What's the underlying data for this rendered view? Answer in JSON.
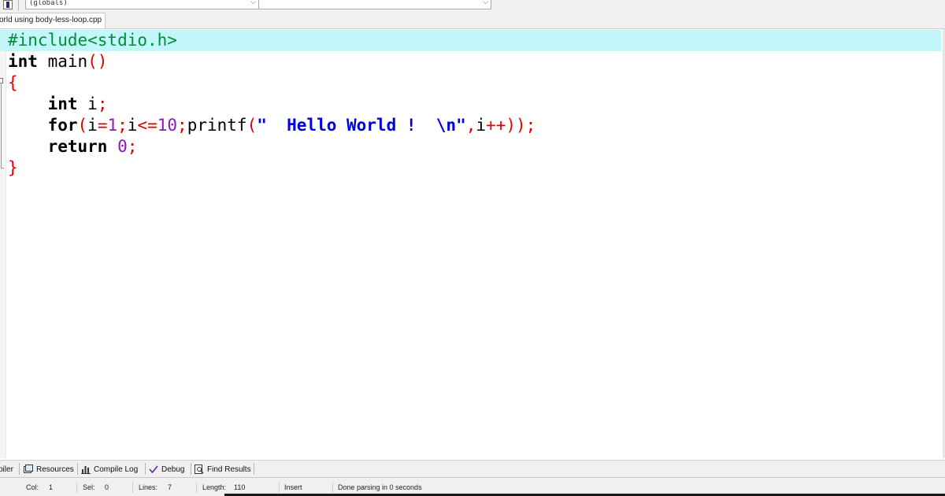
{
  "toolbar": {
    "scope_combo": "(globals)",
    "member_combo": ""
  },
  "file_tab": {
    "label": "orld using body-less-loop.cpp"
  },
  "code": {
    "line1": {
      "pre": "#include<stdio.h>"
    },
    "line2": {
      "kw": "int",
      "name": " main",
      "paren": "()"
    },
    "line3": {
      "brace": "{"
    },
    "line4": {
      "indent": "    ",
      "kw": "int",
      "name": " i",
      "semi": ";"
    },
    "line5": {
      "indent": "    ",
      "kw": "for",
      "p_open": "(",
      "v1": "i",
      "eq": "=",
      "n1": "1",
      "s1": ";",
      "v2": "i",
      "le": "<=",
      "n2": "10",
      "s2": ";",
      "fn": "printf",
      "p2": "(",
      "str": "\"  Hello World !  \\n\"",
      "comma": ",",
      "v3": "i",
      "inc": "++",
      "p_close": "));"
    },
    "line6": {
      "indent": "    ",
      "kw": "return",
      "sp": " ",
      "num": "0",
      "semi": ";"
    },
    "line7": {
      "brace": "}"
    }
  },
  "panel_tabs": {
    "compiler": "piler",
    "resources": "Resources",
    "compile_log": "Compile Log",
    "debug": "Debug",
    "find_results": "Find Results"
  },
  "status": {
    "col_label": "Col:",
    "col_value": "1",
    "sel_label": "Sel:",
    "sel_value": "0",
    "lines_label": "Lines:",
    "lines_value": "7",
    "length_label": "Length:",
    "length_value": "110",
    "mode": "Insert",
    "message": "Done parsing in 0 seconds"
  },
  "colors": {
    "active_line": "#c3f6fb",
    "preprocessor": "#008f35",
    "symbol": "#e00000",
    "number": "#8a1bb7",
    "string": "#0000e0"
  }
}
